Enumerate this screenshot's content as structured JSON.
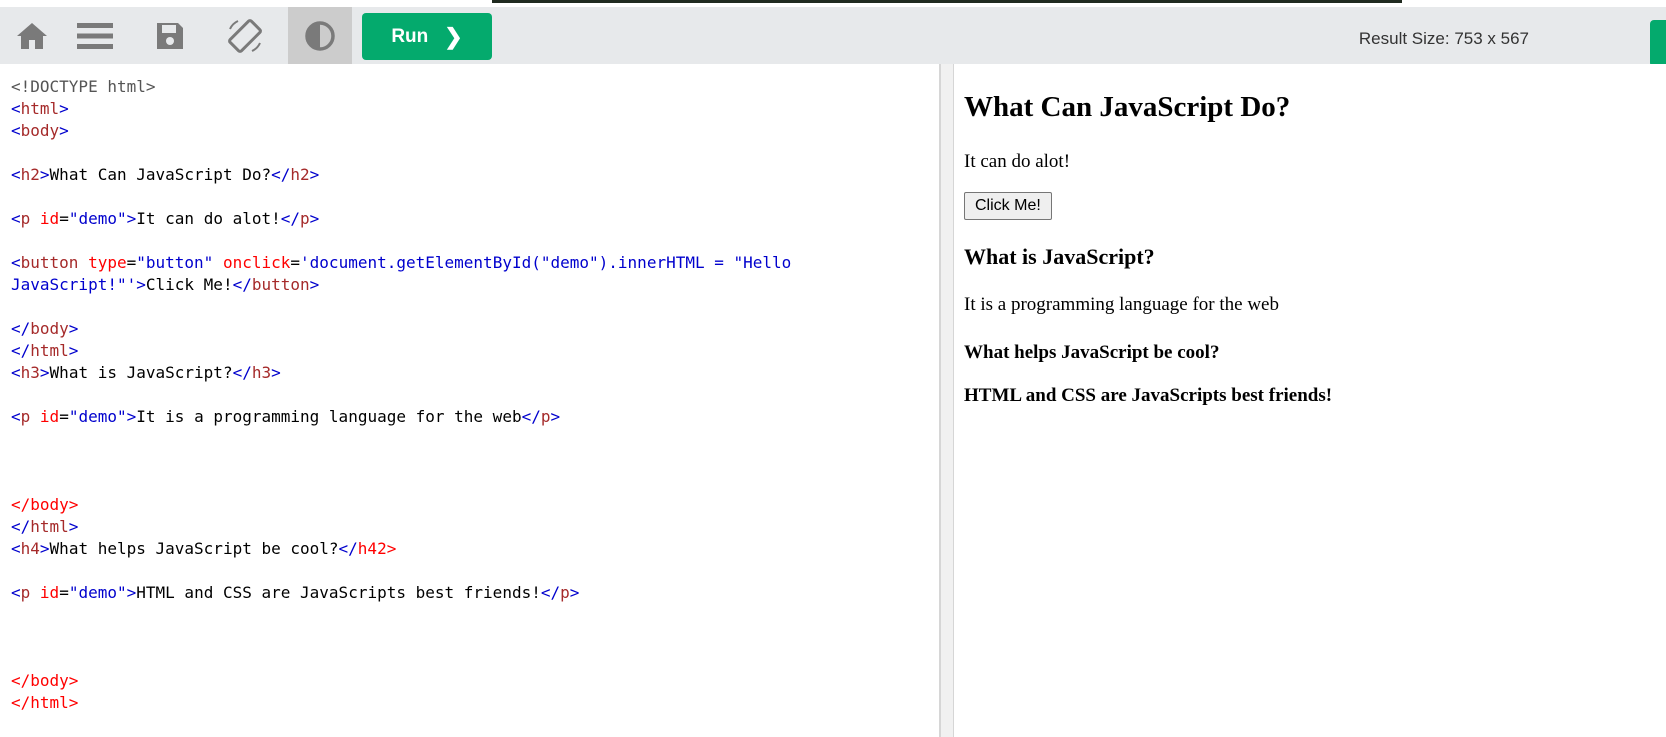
{
  "toolbar": {
    "icons": [
      "home-icon",
      "menu-icon",
      "save-icon",
      "rotate-icon",
      "contrast-icon"
    ],
    "run_label": "Run",
    "run_chevron": "❯",
    "result_size": "Result Size: 753 x 567",
    "colors": {
      "toolbar_bg": "#e7e9eb",
      "run_green": "#04aa6d",
      "icon_gray": "#7a7a7a"
    }
  },
  "editor": {
    "lines": [
      [
        [
          "doc",
          "<!DOCTYPE html>"
        ]
      ],
      [
        [
          "br",
          "<"
        ],
        [
          "tag",
          "html"
        ],
        [
          "br",
          ">"
        ]
      ],
      [
        [
          "br",
          "<"
        ],
        [
          "tag",
          "body"
        ],
        [
          "br",
          ">"
        ]
      ],
      [],
      [
        [
          "br",
          "<"
        ],
        [
          "tag",
          "h2"
        ],
        [
          "br",
          ">"
        ],
        [
          "txt",
          "What Can JavaScript Do?"
        ],
        [
          "br",
          "</"
        ],
        [
          "tag",
          "h2"
        ],
        [
          "br",
          ">"
        ]
      ],
      [],
      [
        [
          "br",
          "<"
        ],
        [
          "tag",
          "p"
        ],
        [
          "txt",
          " "
        ],
        [
          "attr",
          "id"
        ],
        [
          "txt",
          "="
        ],
        [
          "val",
          "\"demo\""
        ],
        [
          "br",
          ">"
        ],
        [
          "txt",
          "It can do alot!"
        ],
        [
          "br",
          "</"
        ],
        [
          "tag",
          "p"
        ],
        [
          "br",
          ">"
        ]
      ],
      [],
      [
        [
          "br",
          "<"
        ],
        [
          "tag",
          "button"
        ],
        [
          "txt",
          " "
        ],
        [
          "attr",
          "type"
        ],
        [
          "txt",
          "="
        ],
        [
          "val",
          "\"button\""
        ],
        [
          "txt",
          " "
        ],
        [
          "attr",
          "onclick"
        ],
        [
          "txt",
          "="
        ],
        [
          "val",
          "'document.getElementById(\"demo\").innerHTML = \"Hello"
        ]
      ],
      [
        [
          "val",
          "JavaScript!\"'"
        ],
        [
          "br",
          ">"
        ],
        [
          "txt",
          "Click Me!"
        ],
        [
          "br",
          "</"
        ],
        [
          "tag",
          "button"
        ],
        [
          "br",
          ">"
        ]
      ],
      [],
      [
        [
          "br",
          "</"
        ],
        [
          "tag",
          "body"
        ],
        [
          "br",
          ">"
        ]
      ],
      [
        [
          "br",
          "</"
        ],
        [
          "tag",
          "html"
        ],
        [
          "br",
          ">"
        ]
      ],
      [
        [
          "br",
          "<"
        ],
        [
          "tag",
          "h3"
        ],
        [
          "br",
          ">"
        ],
        [
          "txt",
          "What is JavaScript?"
        ],
        [
          "br",
          "</"
        ],
        [
          "tag",
          "h3"
        ],
        [
          "br",
          ">"
        ]
      ],
      [],
      [
        [
          "br",
          "<"
        ],
        [
          "tag",
          "p"
        ],
        [
          "txt",
          " "
        ],
        [
          "attr",
          "id"
        ],
        [
          "txt",
          "="
        ],
        [
          "val",
          "\"demo\""
        ],
        [
          "br",
          ">"
        ],
        [
          "txt",
          "It is a programming language for the web"
        ],
        [
          "br",
          "</"
        ],
        [
          "tag",
          "p"
        ],
        [
          "br",
          ">"
        ]
      ],
      [],
      [],
      [],
      [
        [
          "attr",
          "</body>"
        ]
      ],
      [
        [
          "br",
          "</"
        ],
        [
          "tag",
          "html"
        ],
        [
          "br",
          ">"
        ]
      ],
      [
        [
          "br",
          "<"
        ],
        [
          "tag",
          "h4"
        ],
        [
          "br",
          ">"
        ],
        [
          "txt",
          "What helps JavaScript be cool?"
        ],
        [
          "br",
          "</"
        ],
        [
          "attr",
          "h42"
        ],
        [
          "attr",
          ">"
        ]
      ],
      [],
      [
        [
          "br",
          "<"
        ],
        [
          "tag",
          "p"
        ],
        [
          "txt",
          " "
        ],
        [
          "attr",
          "id"
        ],
        [
          "txt",
          "="
        ],
        [
          "val",
          "\"demo\""
        ],
        [
          "br",
          ">"
        ],
        [
          "txt",
          "HTML and CSS are JavaScripts best friends!"
        ],
        [
          "br",
          "</"
        ],
        [
          "tag",
          "p"
        ],
        [
          "br",
          ">"
        ]
      ],
      [],
      [],
      [],
      [
        [
          "attr",
          "</body>"
        ]
      ],
      [
        [
          "attr",
          "</html>"
        ]
      ]
    ]
  },
  "result": {
    "h2": "What Can JavaScript Do?",
    "p1": "It can do alot!",
    "button_label": "Click Me!",
    "h3": "What is JavaScript?",
    "p2": "It is a programming language for the web",
    "h4": "What helps JavaScript be cool?",
    "p3": "HTML and CSS are JavaScripts best friends!"
  }
}
